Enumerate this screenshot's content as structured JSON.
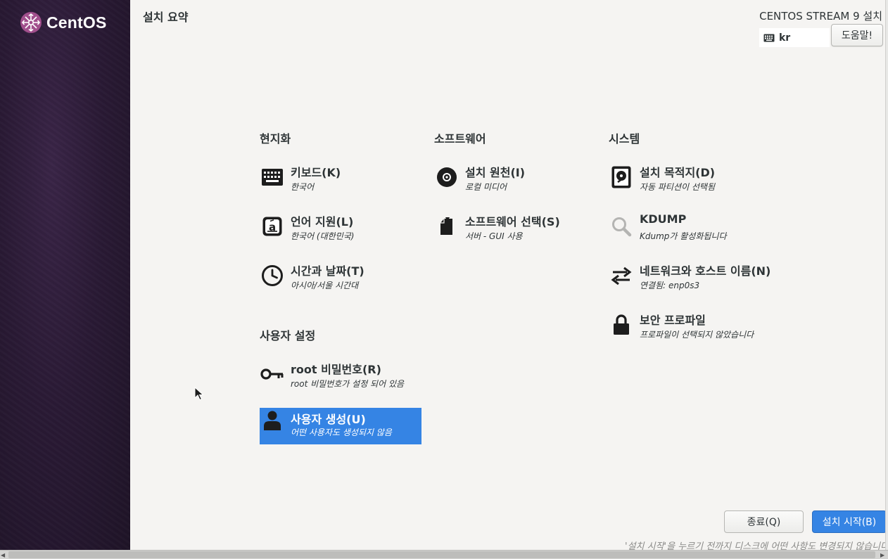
{
  "sidebar": {
    "logo_text": "CentOS"
  },
  "header": {
    "page_title": "설치 요약",
    "product_title": "CENTOS STREAM 9 설치",
    "keyboard_layout": "kr",
    "help_label": "도움말!"
  },
  "sections": {
    "localization": "현지화",
    "software": "소프트웨어",
    "system": "시스템",
    "user_settings": "사용자 설정"
  },
  "spokes": {
    "keyboard": {
      "title": "키보드(K)",
      "status": "한국어",
      "icon": "keyboard-icon"
    },
    "language": {
      "title": "언어 지원(L)",
      "status": "한국어 (대한민국)",
      "icon": "language-icon"
    },
    "datetime": {
      "title": "시간과 날짜(T)",
      "status": "아시아/서울 시간대",
      "icon": "clock-icon"
    },
    "source": {
      "title": "설치 원천(I)",
      "status": "로컬 미디어",
      "icon": "disc-icon"
    },
    "software": {
      "title": "소프트웨어 선택(S)",
      "status": "서버 - GUI 사용",
      "icon": "package-icon"
    },
    "destination": {
      "title": "설치 목적지(D)",
      "status": "자동 파티션이 선택됨",
      "icon": "harddisk-icon"
    },
    "kdump": {
      "title": "KDUMP",
      "status": "Kdump가 활성화됩니다",
      "icon": "magnifier-icon"
    },
    "network": {
      "title": "네트워크와 호스트 이름(N)",
      "status": "연결됨: enp0s3",
      "icon": "network-arrows-icon"
    },
    "security": {
      "title": "보안 프로파일",
      "status": "프로파일이 선택되지 않았습니다",
      "icon": "lock-icon"
    },
    "root": {
      "title": "root 비밀번호(R)",
      "status": "root 비밀번호가 설정 되어 있음",
      "icon": "key-icon"
    },
    "user": {
      "title": "사용자 생성(U)",
      "status": "어떤 사용자도 생성되지 않음",
      "icon": "user-icon"
    }
  },
  "footer": {
    "quit_label": "종료(Q)",
    "begin_label": "설치 시작(B)",
    "note": "'설치 시작'을 누르기 전까지 디스크에 어떤 사항도 변경되지 않습니다"
  },
  "colors": {
    "accent": "#3584e4",
    "sidebar": "#2a1a35"
  }
}
